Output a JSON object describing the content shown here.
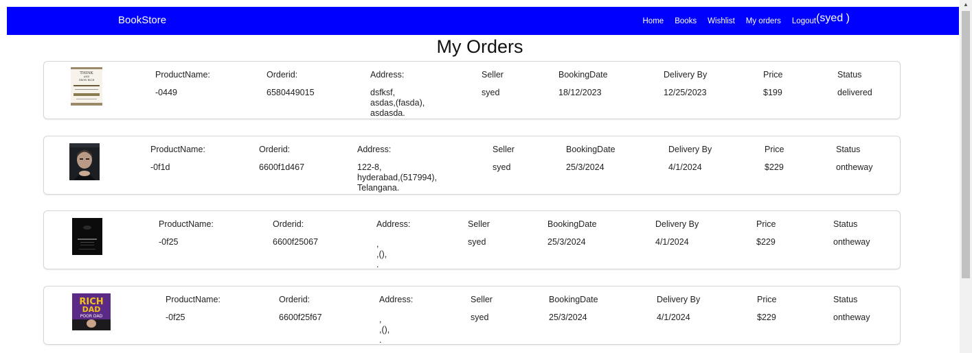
{
  "nav": {
    "brand": "BookStore",
    "links": [
      "Home",
      "Books",
      "Wishlist",
      "My orders",
      "Logout"
    ],
    "user": "(syed )"
  },
  "page": {
    "title": "My Orders"
  },
  "columns": {
    "product": "ProductName:",
    "order": "Orderid:",
    "address": "Address:",
    "seller": "Seller",
    "booking": "BookingDate",
    "delivery": "Delivery By",
    "price": "Price",
    "status": "Status"
  },
  "orders": [
    {
      "book_cover": "think-and-grow-rich",
      "cover_text": [
        "THINK",
        "AND",
        "GROW RICH"
      ],
      "product": "-0449",
      "order_id": "6580449015",
      "address": [
        "dsfksf,",
        "asdas,(fasda),",
        "asdasda."
      ],
      "seller": "syed",
      "booking_date": "18/12/2023",
      "delivery_by": "12/25/2023",
      "price": "$199",
      "status": "delivered"
    },
    {
      "book_cover": "portrait-cover",
      "product": "-0f1d",
      "order_id": "6600f1d467",
      "address": [
        "122-8,",
        "hyderabad,(517994),",
        "Telangana."
      ],
      "seller": "syed",
      "booking_date": "25/3/2024",
      "delivery_by": "4/1/2024",
      "price": "$229",
      "status": "ontheway"
    },
    {
      "book_cover": "dark-cover",
      "product": "-0f25",
      "order_id": "6600f25067",
      "address": [
        ",",
        ",(),",
        "."
      ],
      "seller": "syed",
      "booking_date": "25/3/2024",
      "delivery_by": "4/1/2024",
      "price": "$229",
      "status": "ontheway"
    },
    {
      "book_cover": "rich-dad-poor-dad",
      "cover_text": [
        "RICH",
        "DAD",
        "POOR DAD"
      ],
      "product": "-0f25",
      "order_id": "6600f25f67",
      "address": [
        ",",
        ",(),",
        "."
      ],
      "seller": "syed",
      "booking_date": "25/3/2024",
      "delivery_by": "4/1/2024",
      "price": "$229",
      "status": "ontheway"
    }
  ],
  "colors": {
    "navbar": "#0000ff",
    "card_border": "#d6d6d6"
  }
}
